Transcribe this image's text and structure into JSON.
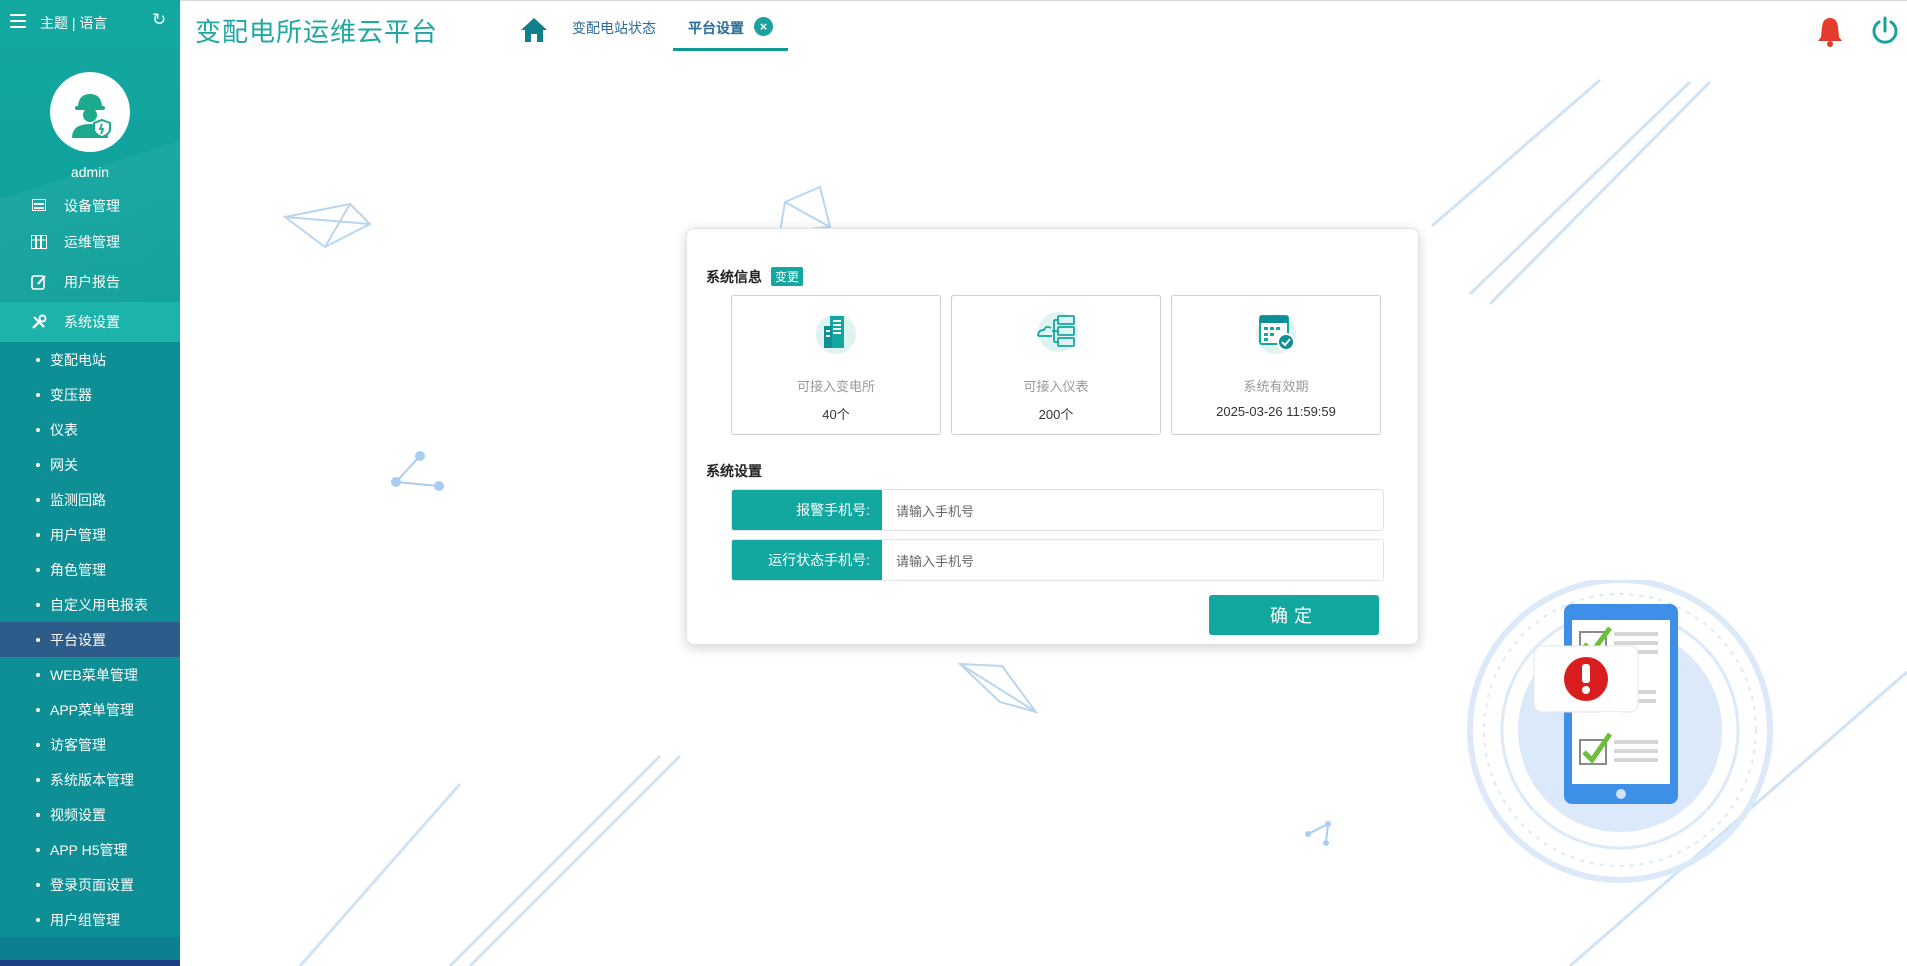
{
  "header": {
    "site_title": "变配电所运维云平台",
    "tabs": [
      {
        "label": "变配电站状态"
      },
      {
        "label": "平台设置"
      }
    ],
    "close_symbol": "×"
  },
  "sidebar": {
    "theme_language": "主题 | 语言",
    "username": "admin",
    "nav": [
      {
        "label": "设备管理",
        "icon": "device-icon"
      },
      {
        "label": "运维管理",
        "icon": "maintenance-icon"
      },
      {
        "label": "用户报告",
        "icon": "report-edit-icon"
      },
      {
        "label": "系统设置",
        "icon": "tools-icon"
      }
    ],
    "sub_items": [
      {
        "label": "变配电站"
      },
      {
        "label": "变压器"
      },
      {
        "label": "仪表"
      },
      {
        "label": "网关"
      },
      {
        "label": "监测回路"
      },
      {
        "label": "用户管理"
      },
      {
        "label": "角色管理"
      },
      {
        "label": "自定义用电报表"
      },
      {
        "label": "平台设置"
      },
      {
        "label": "WEB菜单管理"
      },
      {
        "label": "APP菜单管理"
      },
      {
        "label": "访客管理"
      },
      {
        "label": "系统版本管理"
      },
      {
        "label": "视频设置"
      },
      {
        "label": "APP H5管理"
      },
      {
        "label": "登录页面设置"
      },
      {
        "label": "用户组管理"
      }
    ],
    "active_sub": "平台设置"
  },
  "card": {
    "system_info_title": "系统信息",
    "change_badge": "变更",
    "info_boxes": [
      {
        "label": "可接入变电所",
        "value": "40个",
        "icon": "substation-icon"
      },
      {
        "label": "可接入仪表",
        "value": "200个",
        "icon": "cloud-server-icon"
      },
      {
        "label": "系统有效期",
        "value": "2025-03-26 11:59:59",
        "icon": "calendar-check-icon"
      }
    ],
    "system_settings_title": "系统设置",
    "fields": [
      {
        "label": "报警手机号:",
        "placeholder": "请输入手机号"
      },
      {
        "label": "运行状态手机号:",
        "placeholder": "请输入手机号"
      }
    ],
    "confirm": "确定"
  },
  "colors": {
    "primary": "#12a8a0",
    "sidebar_active": "#2e5c8a",
    "title": "#20a7a3",
    "bell": "#e53b2c"
  }
}
